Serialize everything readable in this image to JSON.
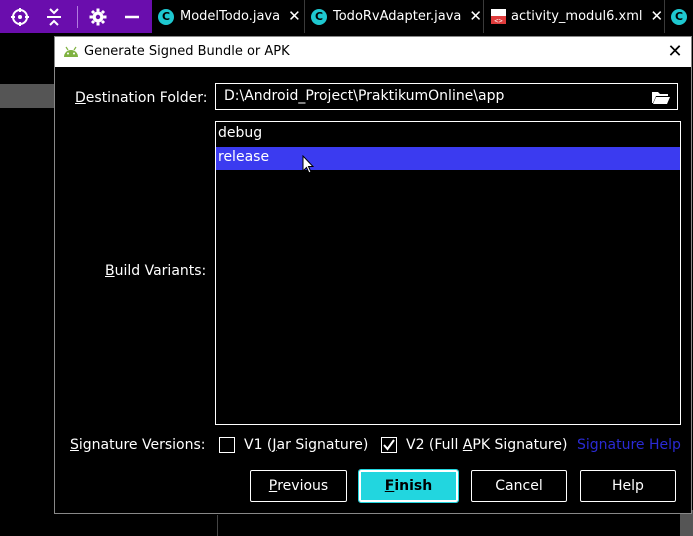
{
  "toolbar": {
    "icons": [
      "crosshair-icon",
      "collapse-icon",
      "gear-icon",
      "minimize-icon"
    ]
  },
  "tabs": [
    {
      "label": "ModelTodo.java",
      "icon": "c"
    },
    {
      "label": "TodoRvAdapter.java",
      "icon": "c"
    },
    {
      "label": "activity_modul6.xml",
      "icon": "xml"
    },
    {
      "label": "",
      "icon": "c"
    }
  ],
  "dialog": {
    "title": "Generate Signed Bundle or APK",
    "destination_label": "Destination Folder:",
    "destination_value": "D:\\Android_Project\\PraktikumOnline\\app",
    "build_variants_label": "Build Variants:",
    "variants": [
      {
        "label": "debug",
        "selected": false
      },
      {
        "label": "release",
        "selected": true
      }
    ],
    "signature_label": "Signature Versions:",
    "v1_label": "V1 (Jar Signature)",
    "v1_checked": false,
    "v2_label": "V2 (Full APK Signature)",
    "v2_checked": true,
    "signature_help": "Signature Help",
    "buttons": {
      "previous": "Previous",
      "finish": "Finish",
      "cancel": "Cancel",
      "help": "Help"
    }
  },
  "colors": {
    "accent": "#22d6df",
    "selection": "#3b3bf0",
    "toolbar": "#6a0dad",
    "link": "#2a2ad4"
  }
}
